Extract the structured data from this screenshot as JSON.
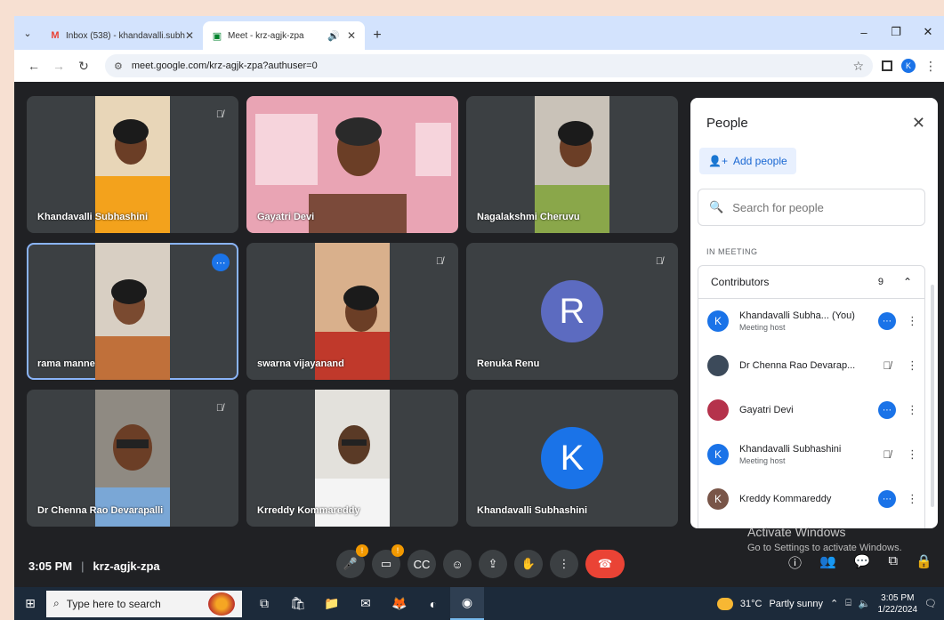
{
  "browser": {
    "tabs": [
      {
        "favicon": "M",
        "title": "Inbox (538) - khandavalli.subha",
        "close": "✕"
      },
      {
        "favicon": "▣",
        "title": "Meet - krz-agjk-zpa",
        "close": "✕"
      }
    ],
    "new_tab": "+",
    "url": "meet.google.com/krz-agjk-zpa?authuser=0",
    "profile_initial": "K"
  },
  "tiles": [
    {
      "name": "Khandavalli Subhashini"
    },
    {
      "name": "Gayatri Devi"
    },
    {
      "name": "Nagalakshmi Cheruvu"
    },
    {
      "name": "rama manne"
    },
    {
      "name": "swarna vijayanand"
    },
    {
      "name": "Renuka Renu",
      "initial": "R"
    },
    {
      "name": "Dr Chenna Rao Devarapalli"
    },
    {
      "name": "Krreddy Kommareddy"
    },
    {
      "name": "Khandavalli Subhashini",
      "initial": "K"
    }
  ],
  "meeting": {
    "time": "3:05 PM",
    "separator": "|",
    "code": "krz-agjk-zpa",
    "mic_badge": "!",
    "cam_badge": "!"
  },
  "people_panel": {
    "title": "People",
    "add_people": "Add people",
    "search_placeholder": "Search for people",
    "section": "IN MEETING",
    "group_label": "Contributors",
    "group_count": "9",
    "participants": [
      {
        "initial": "K",
        "name": "Khandavalli Subha...  (You)",
        "sub": "Meeting host",
        "avatar_color": "#1a73e8"
      },
      {
        "initial": "",
        "name": "Dr Chenna Rao Devarap...",
        "sub": "",
        "avatar_color": "#3c4a5a"
      },
      {
        "initial": "",
        "name": "Gayatri Devi",
        "sub": "",
        "avatar_color": "#b5324b"
      },
      {
        "initial": "K",
        "name": "Khandavalli Subhashini",
        "sub": "Meeting host",
        "avatar_color": "#1a73e8"
      },
      {
        "initial": "K",
        "name": "Kreddy Kommareddy",
        "sub": "",
        "avatar_color": "#795548"
      }
    ]
  },
  "watermark": {
    "title": "Activate Windows",
    "sub": "Go to Settings to activate Windows."
  },
  "taskbar": {
    "search_placeholder": "Type here to search",
    "temperature": "31°C",
    "weather": "Partly sunny",
    "time": "3:05 PM",
    "date": "1/22/2024"
  },
  "colors": {
    "renuka_avatar": "#5c6bc0",
    "khandavalli_avatar": "#1a73e8",
    "end_call": "#ea4335"
  }
}
